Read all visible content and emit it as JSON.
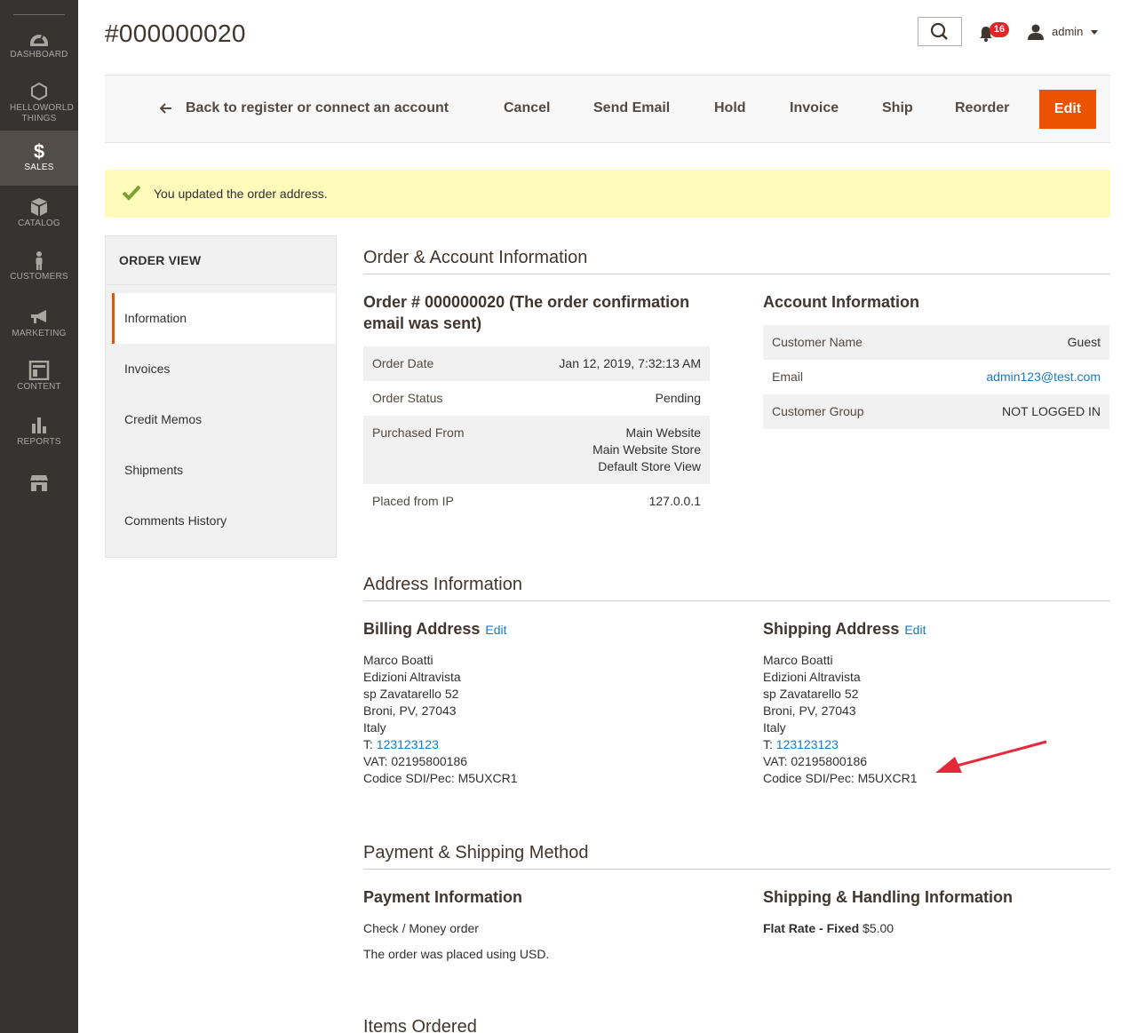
{
  "sidebar": {
    "items": [
      {
        "label": "Dashboard",
        "icon": "dashboard-icon"
      },
      {
        "label": "Helloworld Things",
        "icon": "hexagon-icon"
      },
      {
        "label": "Sales",
        "icon": "dollar-icon"
      },
      {
        "label": "Catalog",
        "icon": "box-icon"
      },
      {
        "label": "Customers",
        "icon": "person-icon"
      },
      {
        "label": "Marketing",
        "icon": "megaphone-icon"
      },
      {
        "label": "Content",
        "icon": "layout-icon"
      },
      {
        "label": "Reports",
        "icon": "bar-chart-icon"
      },
      {
        "label": "",
        "icon": "store-icon"
      }
    ]
  },
  "header": {
    "title": "#000000020",
    "notifications_count": "16",
    "user": "admin"
  },
  "actions": {
    "back": "Back to register or connect an account",
    "cancel": "Cancel",
    "send_email": "Send Email",
    "hold": "Hold",
    "invoice": "Invoice",
    "ship": "Ship",
    "reorder": "Reorder",
    "edit": "Edit"
  },
  "message": "You updated the order address.",
  "tabs": {
    "title": "ORDER VIEW",
    "items": [
      "Information",
      "Invoices",
      "Credit Memos",
      "Shipments",
      "Comments History"
    ]
  },
  "order_account": {
    "section_title": "Order & Account Information",
    "order_heading": "Order # 000000020 (The order confirmation email was sent)",
    "order_rows": [
      {
        "label": "Order Date",
        "value": "Jan 12, 2019, 7:32:13 AM"
      },
      {
        "label": "Order Status",
        "value": "Pending"
      },
      {
        "label": "Purchased From",
        "value_lines": [
          "Main Website",
          "Main Website Store",
          "Default Store View"
        ]
      },
      {
        "label": "Placed from IP",
        "value": "127.0.0.1"
      }
    ],
    "account_heading": "Account Information",
    "account_rows": [
      {
        "label": "Customer Name",
        "value": "Guest"
      },
      {
        "label": "Email",
        "value": "admin123@test.com"
      },
      {
        "label": "Customer Group",
        "value": "NOT LOGGED IN"
      }
    ]
  },
  "address": {
    "section_title": "Address Information",
    "edit_label": "Edit",
    "billing": {
      "heading": "Billing Address",
      "name": "Marco Boatti",
      "company": "Edizioni Altravista",
      "street": "sp Zavatarello 52",
      "city": "Broni, PV, 27043",
      "country": "Italy",
      "phone_prefix": "T: ",
      "phone": "123123123",
      "vat": "VAT: 02195800186",
      "sdi": "Codice SDI/Pec: M5UXCR1"
    },
    "shipping": {
      "heading": "Shipping Address",
      "name": "Marco Boatti",
      "company": "Edizioni Altravista",
      "street": "sp Zavatarello 52",
      "city": "Broni, PV, 27043",
      "country": "Italy",
      "phone_prefix": "T: ",
      "phone": "123123123",
      "vat": "VAT: 02195800186",
      "sdi": "Codice SDI/Pec: M5UXCR1"
    }
  },
  "payment_shipping": {
    "section_title": "Payment & Shipping Method",
    "payment_heading": "Payment Information",
    "payment_method": "Check / Money order",
    "payment_note": "The order was placed using USD.",
    "shipping_heading": "Shipping & Handling Information",
    "shipping_method": "Flat Rate - Fixed",
    "shipping_price": "$5.00"
  },
  "items": {
    "section_title": "Items Ordered"
  },
  "colors": {
    "accent": "#eb5202",
    "sidebar": "#373330",
    "link": "#1979c3",
    "message_bg": "#fffbbb",
    "annotation_arrow": "#e8283a"
  }
}
